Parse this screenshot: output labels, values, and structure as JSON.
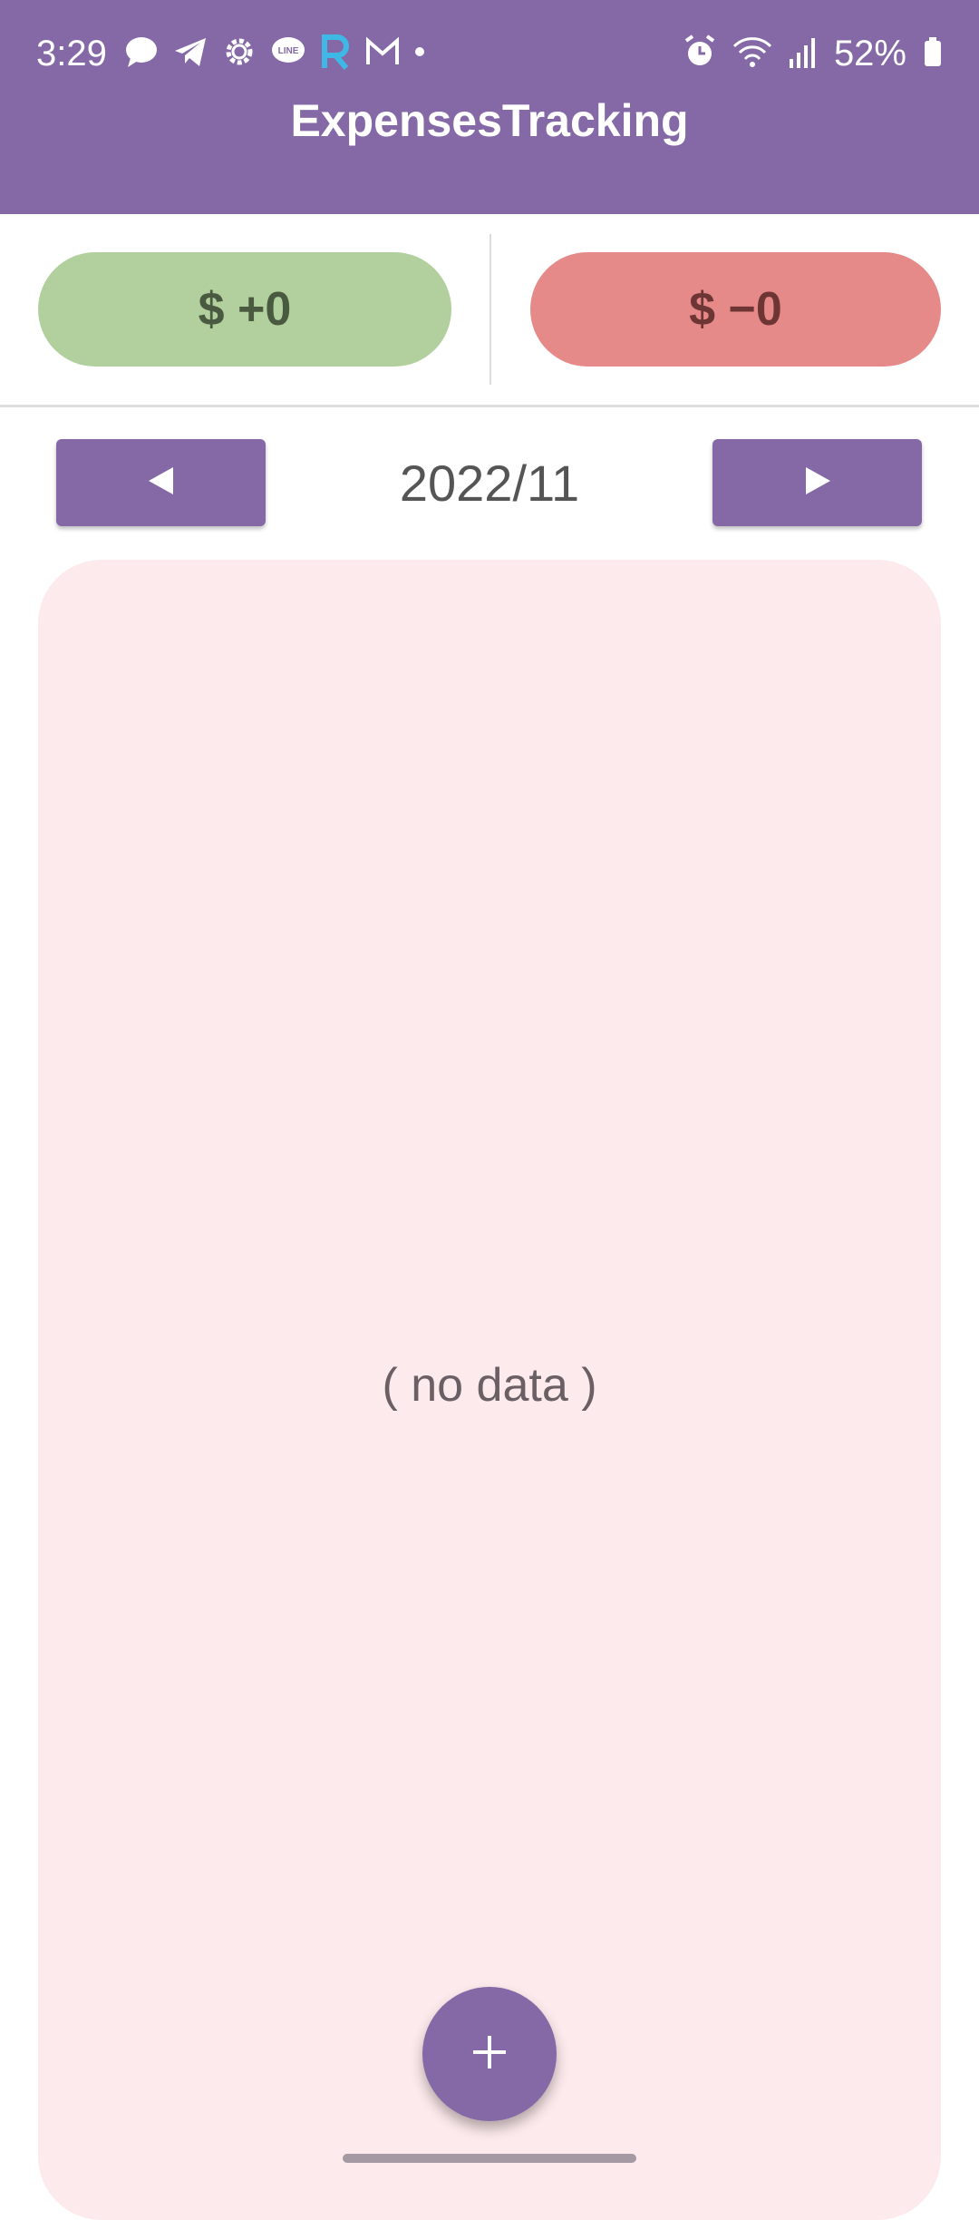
{
  "status_bar": {
    "time": "3:29",
    "battery": "52%",
    "icons_left": [
      "chat-icon",
      "telegram-icon",
      "settings-icon",
      "line-icon",
      "r-app-icon",
      "gmail-icon",
      "dot-icon"
    ],
    "icons_right": [
      "alarm-icon",
      "wifi-icon",
      "signal-icon",
      "battery-icon"
    ]
  },
  "app_bar": {
    "title": "ExpensesTracking"
  },
  "summary": {
    "income": "$ +0",
    "expense": "$ −0"
  },
  "month_nav": {
    "current": "2022/11",
    "prev_icon": "triangle-left-icon",
    "next_icon": "triangle-right-icon"
  },
  "content": {
    "empty_text": "( no data )"
  },
  "fab": {
    "icon": "plus-icon"
  },
  "colors": {
    "primary": "#8469a6",
    "income": "#b2cf9e",
    "expense": "#e58a89",
    "card_bg": "#fdeaec"
  }
}
